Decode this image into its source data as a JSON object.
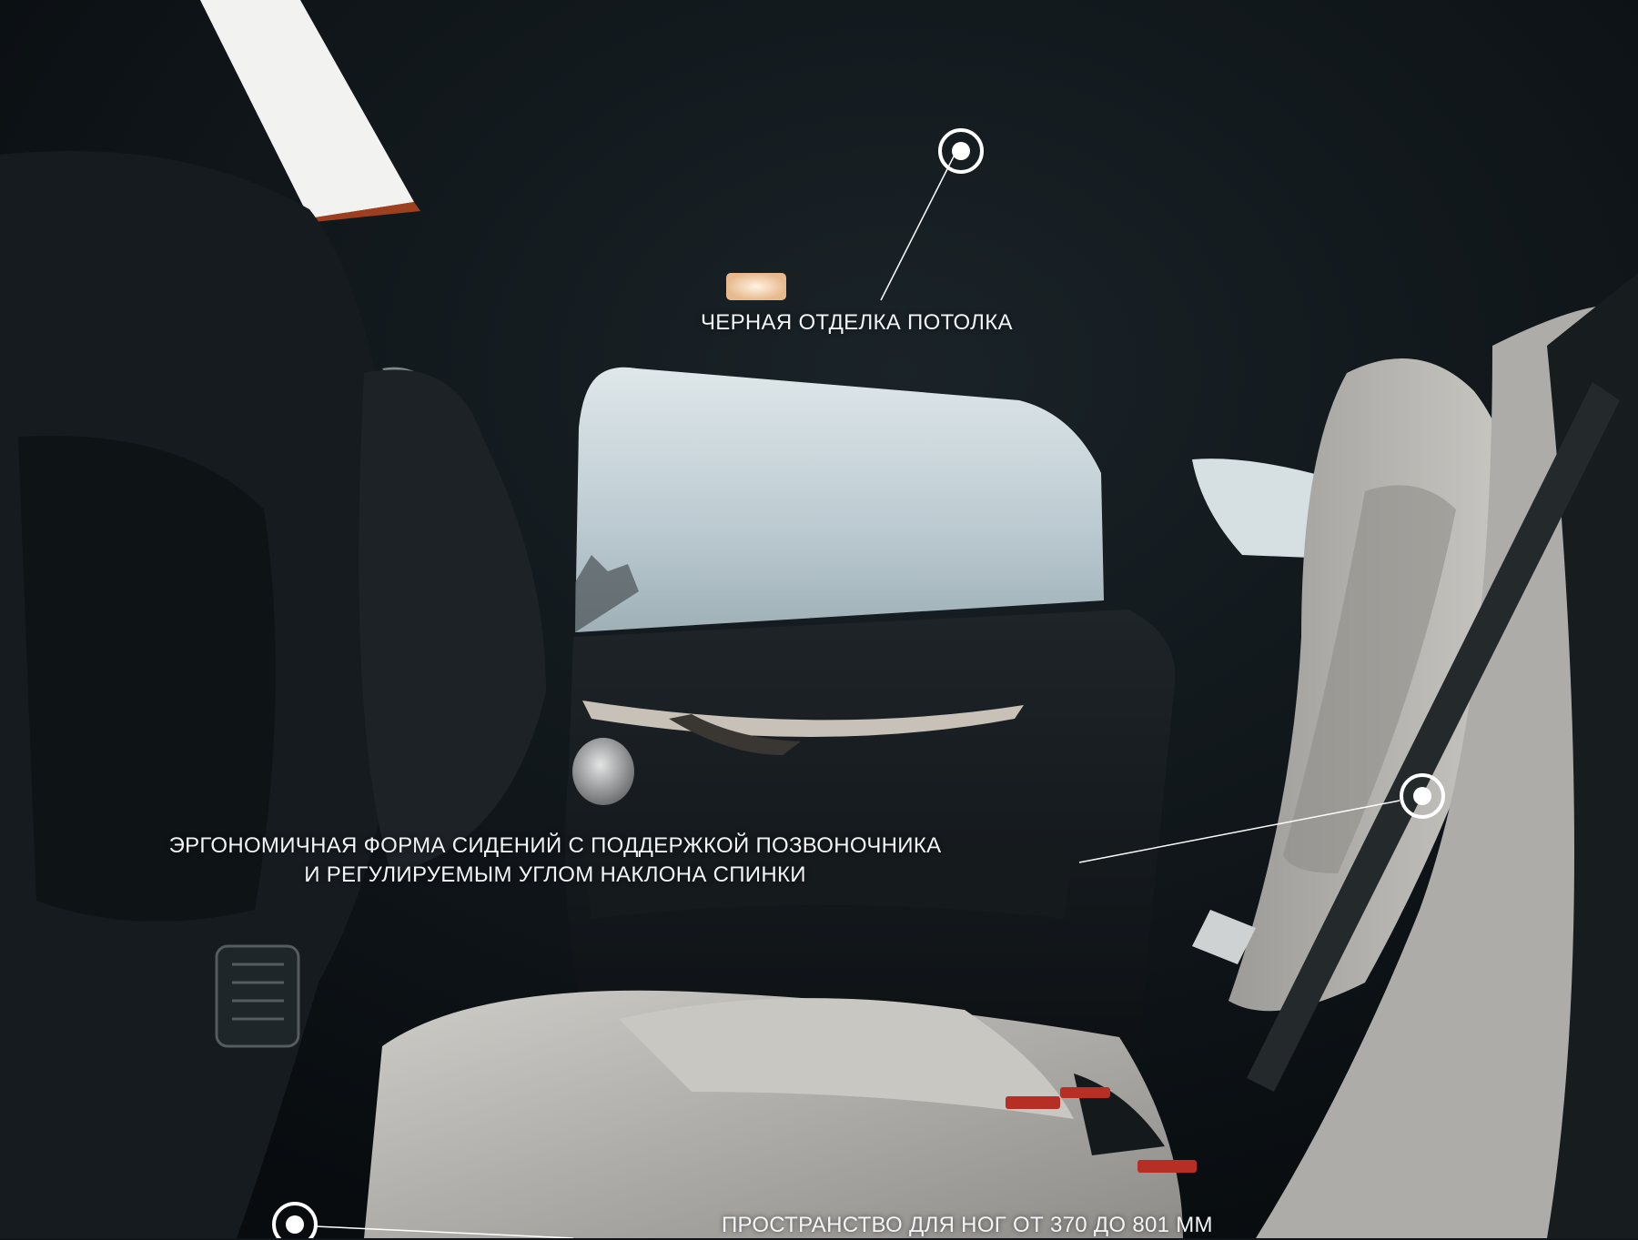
{
  "callouts": {
    "ceiling": {
      "label": "ЧЕРНАЯ ОТДЕЛКА ПОТОЛКА"
    },
    "seats": {
      "line1": "ЭРГОНОМИЧНАЯ ФОРМА СИДЕНИЙ С ПОДДЕРЖКОЙ ПОЗВОНОЧНИКА",
      "line2": "И РЕГУЛИРУЕМЫМ УГЛОМ НАКЛОНА СПИНКИ"
    },
    "legroom": {
      "label": "ПРОСТРАНСТВО ДЛЯ НОГ ОТ 370 ДО 801 ММ"
    }
  },
  "colors": {
    "headliner": "#0c1216",
    "window_sky": "#cdd9de",
    "seat_light": "#b5b3af",
    "seat_dark": "#1b2024",
    "callout": "#ffffff"
  }
}
